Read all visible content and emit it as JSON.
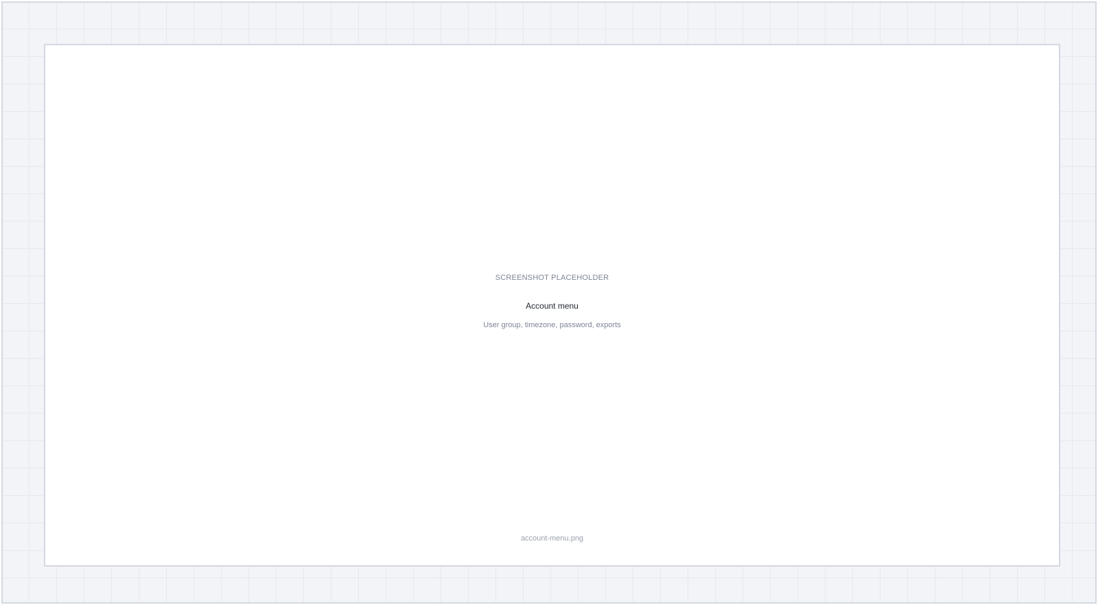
{
  "placeholder": {
    "kicker": "SCREENSHOT PLACEHOLDER",
    "title": "Account menu",
    "subtitle": "User group, timezone, password, exports",
    "filename": "account-menu.png"
  },
  "colors": {
    "page_background": "#f3f4f7",
    "grid_line": "#e6e8ee",
    "border": "#d4d8e2",
    "card_background": "#ffffff",
    "title_text": "#1f2430",
    "muted_text": "#7d8494"
  }
}
